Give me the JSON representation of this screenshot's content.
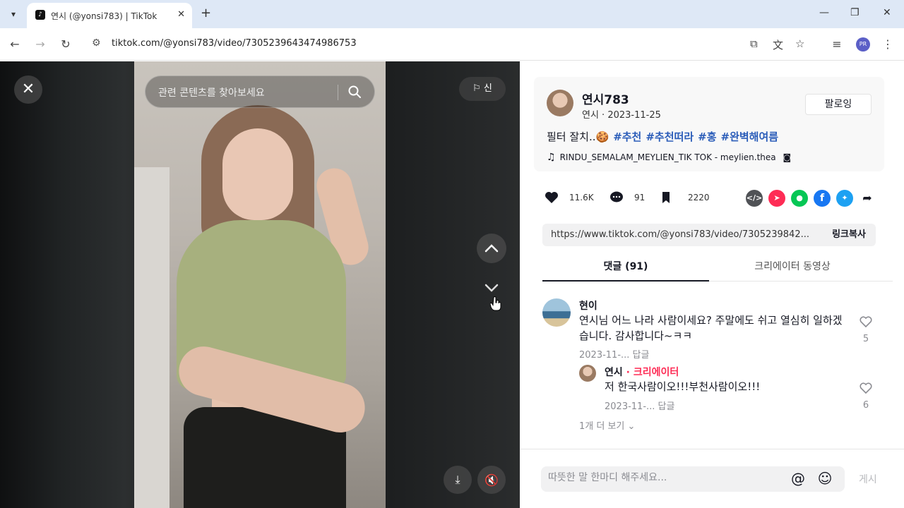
{
  "browser": {
    "tab_title": "연시 (@yonsi783) | TikTok",
    "favicon": "TikTok",
    "url": "tiktok.com/@yonsi783/video/7305239643474986753",
    "new_tab": "+",
    "profile": "PR"
  },
  "video": {
    "search_placeholder": "관련 콘텐츠를 찾아보세요",
    "report_label": "⚐ 신",
    "close_symbol": "✕"
  },
  "author": {
    "name": "연시783",
    "subline": "연시 · 2023-11-25",
    "follow_label": "팔로잉",
    "caption_text": "필터 잘치..🍪",
    "hashtags": [
      "#추천",
      "#추천떠라",
      "#홍",
      "#완벽해여름"
    ],
    "music": "RINDU_SEMALAM_MEYLIEN_TIK TOK - meylien.thea"
  },
  "stats": {
    "likes": "11.6K",
    "comments": "91",
    "saves": "2220"
  },
  "share": {
    "link_url": "https://www.tiktok.com/@yonsi783/video/7305239842...",
    "copy_label": "링크복사",
    "colors": {
      "embed": "#505256",
      "tiktok": "#fe2c55",
      "line": "#06c755",
      "facebook": "#1877f2",
      "twitter": "#1da1f2"
    }
  },
  "tabs": [
    {
      "label": "댓글 (91)"
    },
    {
      "label": "크리에이터 동영상"
    }
  ],
  "comments": [
    {
      "user": "현이",
      "text": "연시님 어느 나라 사람이세요? 주말에도 쉬고 열심히 일하겠습니다. 감사합니다~ㅋㅋ",
      "meta": "2023-11-...  답글",
      "likes": "5"
    },
    {
      "user": "연시",
      "creator_tag": " · 크리에이터",
      "text": "저 한국사람이오!!!부천사람이오!!!",
      "meta": "2023-11-...  답글",
      "likes": "6"
    }
  ],
  "more_replies": "1개 더 보기 ⌄",
  "input": {
    "placeholder": "따뜻한 말 한마디 해주세요...",
    "post_label": "게시"
  }
}
